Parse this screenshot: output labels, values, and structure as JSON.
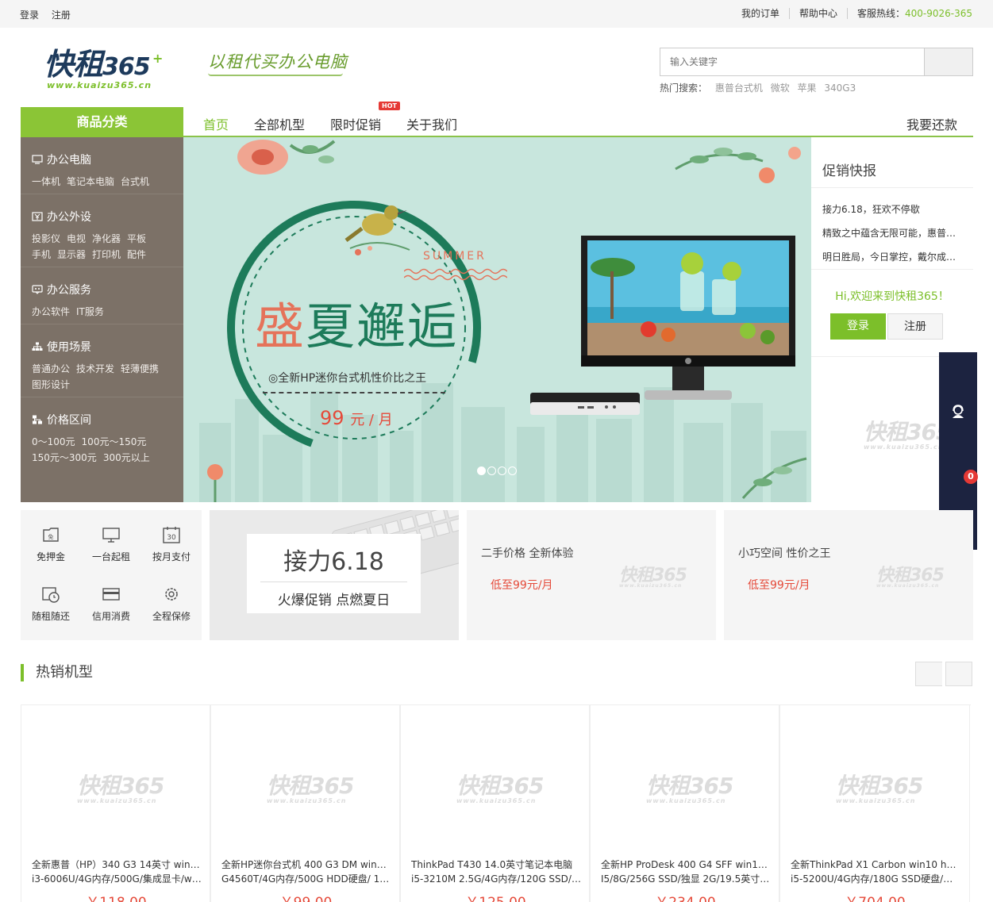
{
  "topbar": {
    "login": "登录",
    "register": "注册",
    "orders": "我的订单",
    "help": "帮助中心",
    "hotline_label": "客服热线：",
    "hotline_number": "400-9026-365"
  },
  "header": {
    "logo_main": "快租",
    "logo_num": "365",
    "logo_url": "www.kuaizu365.cn",
    "slogan": "以租代买办公电脑",
    "search_placeholder": "输入关键字",
    "hot_label": "热门搜索：",
    "hot_keywords": [
      "惠普台式机",
      "微软",
      "苹果",
      "340G3"
    ]
  },
  "nav": {
    "category": "商品分类",
    "links": [
      "首页",
      "全部机型",
      "限时促销",
      "关于我们"
    ],
    "hot_badge": "HOT",
    "repay": "我要还款"
  },
  "sidebar": [
    {
      "title": "办公电脑",
      "icon": "monitor-icon",
      "subs": [
        [
          "一体机",
          "笔记本电脑",
          "台式机"
        ]
      ]
    },
    {
      "title": "办公外设",
      "icon": "yen-icon",
      "subs": [
        [
          "投影仪",
          "电视",
          "净化器",
          "平板"
        ],
        [
          "手机",
          "显示器",
          "打印机",
          "配件"
        ]
      ]
    },
    {
      "title": "办公服务",
      "icon": "service-icon",
      "subs": [
        [
          "办公软件",
          "IT服务"
        ]
      ]
    },
    {
      "title": "使用场景",
      "icon": "sitemap-icon",
      "subs": [
        [
          "普通办公",
          "技术开发",
          "轻薄便携"
        ],
        [
          "图形设计"
        ]
      ]
    },
    {
      "title": "价格区间",
      "icon": "tree-icon",
      "subs": [
        [
          "0～100元",
          "100元～150元"
        ],
        [
          "150元～300元",
          "300元以上"
        ]
      ]
    }
  ],
  "banner": {
    "summer": "SUMMER",
    "headline_part1": "盛",
    "headline_part2": "夏邂逅",
    "subtitle": "◎全新HP迷你台式机性价比之王",
    "price": "99",
    "price_unit": "元 / 月",
    "active_slide": 1
  },
  "promo": {
    "title": "促销快报",
    "news": [
      "接力6.18，狂欢不停歇",
      "精致之中蕴含无限可能，惠普…",
      "明日胜局，今日掌控，戴尔成…"
    ],
    "welcome": "Hi,欢迎来到快租365！",
    "login": "登录",
    "register": "注册"
  },
  "floatbar": {
    "cart_count": "0"
  },
  "features": [
    "免押金",
    "一台起租",
    "按月支付",
    "随租随还",
    "信用消费",
    "全程保修"
  ],
  "card618": {
    "title": "接力6.18",
    "subtitle": "火爆促销 点燃夏日"
  },
  "cards": [
    {
      "title": "二手价格 全新体验",
      "price": "低至99元/月"
    },
    {
      "title": "小巧空间 性价之王",
      "price": "低至99元/月"
    }
  ],
  "hot_section": {
    "title": "热销机型"
  },
  "products": [
    {
      "line1": "全新惠普（HP）340 G3 14英寸 win1…",
      "line2": "i3-6006U/4G内存/500G/集成显卡/w…",
      "price": "￥118.00"
    },
    {
      "line1": "全新HP迷你台式机 400 G3 DM win1…",
      "line2": "G4560T/4G内存/500G HDD硬盘/ 19…",
      "price": "￥99.00"
    },
    {
      "line1": "ThinkPad T430 14.0英寸笔记本电脑",
      "line2": "i5-3210M 2.5G/4G内存/120G SSD/…",
      "price": "￥125.00"
    },
    {
      "line1": "全新HP ProDesk 400 G4 SFF win10…",
      "line2": "I5/8G/256G SSD/独显 2G/19.5英寸…",
      "price": "￥234.00"
    },
    {
      "line1": "全新ThinkPad X1 Carbon win10 ho…",
      "line2": "i5-5200U/4G内存/180G SSD硬盘/集…",
      "price": "￥704.00"
    }
  ]
}
